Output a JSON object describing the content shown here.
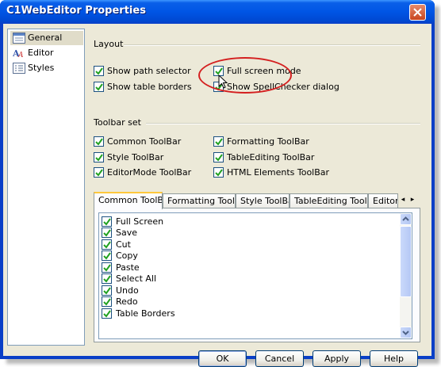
{
  "window": {
    "title": "C1WebEditor Properties"
  },
  "nav": {
    "items": [
      {
        "label": "General",
        "selected": true,
        "icon": "general-icon"
      },
      {
        "label": "Editor",
        "selected": false,
        "icon": "editor-icon"
      },
      {
        "label": "Styles",
        "selected": false,
        "icon": "styles-icon"
      }
    ]
  },
  "layout": {
    "heading": "Layout",
    "show_path_selector": {
      "label": "Show path selector",
      "checked": true
    },
    "show_table_borders": {
      "label": "Show table borders",
      "checked": true
    },
    "full_screen_mode": {
      "label": "Full screen mode",
      "checked": true
    },
    "show_spellchecker": {
      "label": "Show SpellChecker dialog",
      "checked": true
    }
  },
  "toolbar_set": {
    "heading": "Toolbar set",
    "common": {
      "label": "Common ToolBar",
      "checked": true
    },
    "style": {
      "label": "Style ToolBar",
      "checked": true
    },
    "editormode": {
      "label": "EditorMode ToolBar",
      "checked": true
    },
    "formatting": {
      "label": "Formatting ToolBar",
      "checked": true
    },
    "tableediting": {
      "label": "TableEditing ToolBar",
      "checked": true
    },
    "htmlelements": {
      "label": "HTML Elements ToolBar",
      "checked": true
    }
  },
  "tabs": [
    {
      "label": "Common ToolBar",
      "active": true
    },
    {
      "label": "Formatting ToolBar",
      "active": false
    },
    {
      "label": "Style ToolBar",
      "active": false
    },
    {
      "label": "TableEditing ToolBar",
      "active": false
    },
    {
      "label": "EditorM",
      "active": false
    }
  ],
  "common_toolbar_items": [
    {
      "label": "Full Screen",
      "checked": true
    },
    {
      "label": "Save",
      "checked": true
    },
    {
      "label": "Cut",
      "checked": true
    },
    {
      "label": "Copy",
      "checked": true
    },
    {
      "label": "Paste",
      "checked": true
    },
    {
      "label": "Select All",
      "checked": true
    },
    {
      "label": "Undo",
      "checked": true
    },
    {
      "label": "Redo",
      "checked": true
    },
    {
      "label": "Table Borders",
      "checked": true
    }
  ],
  "buttons": {
    "ok": "OK",
    "cancel": "Cancel",
    "apply": "Apply",
    "help": "Help"
  },
  "colors": {
    "titlebar": "#0055e5",
    "face": "#ece9d8",
    "check": "#21a121",
    "highlight": "#d42020"
  }
}
